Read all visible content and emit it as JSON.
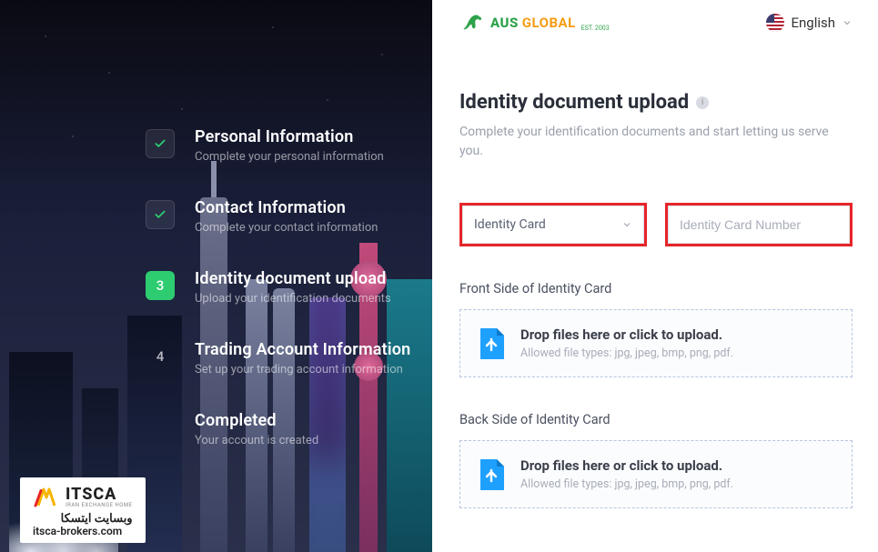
{
  "brand": {
    "aus": "AUS",
    "global": "GLOBAL",
    "est": "EST. 2003"
  },
  "language": {
    "label": "English"
  },
  "steps": [
    {
      "title": "Personal Information",
      "sub": "Complete your personal information",
      "state": "done"
    },
    {
      "title": "Contact Information",
      "sub": "Complete your contact information",
      "state": "done"
    },
    {
      "title": "Identity document upload",
      "sub": "Upload your identification documents",
      "state": "active",
      "num": "3"
    },
    {
      "title": "Trading Account Information",
      "sub": "Set up your trading account information",
      "state": "pending",
      "num": "4"
    },
    {
      "title": "Completed",
      "sub": "Your account is created",
      "state": "pending",
      "num": ""
    }
  ],
  "main": {
    "title": "Identity document upload",
    "sub": "Complete your identification documents and start letting us serve you."
  },
  "form": {
    "doc_type": {
      "selected": "Identity Card"
    },
    "doc_number": {
      "placeholder": "Identity Card Number",
      "value": ""
    }
  },
  "upload": {
    "front_label": "Front Side of Identity Card",
    "back_label": "Back Side of Identity Card",
    "drop_main": "Drop files here or click to upload.",
    "drop_sub": "Allowed file types: jpg, jpeg, bmp, png, pdf."
  },
  "itsca": {
    "main": "ITSCA",
    "tag": "IRAN EXCHANGE HOME",
    "ar": "وبسایت ایتسکا",
    "url": "itsca-brokers.com"
  },
  "colors": {
    "accent_green": "#2ecc71",
    "highlight_red": "#e6252a",
    "upload_blue": "#1ea0ff"
  }
}
